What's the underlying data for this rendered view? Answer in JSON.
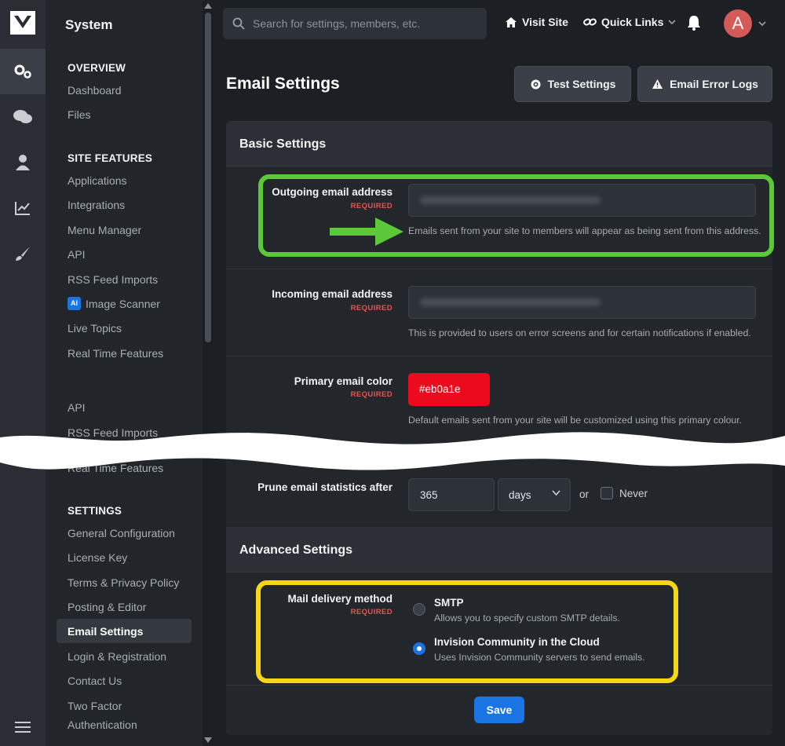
{
  "sidebar": {
    "title": "System",
    "sections": [
      {
        "heading": "OVERVIEW",
        "items": [
          "Dashboard",
          "Files"
        ]
      },
      {
        "heading": "SITE FEATURES",
        "items": [
          "Applications",
          "Integrations",
          "Menu Manager",
          "API",
          "RSS Feed Imports",
          "Image Scanner",
          "Live Topics",
          "Real Time Features"
        ]
      },
      {
        "heading": "SETTINGS",
        "items": [
          "General Configuration",
          "License Key",
          "Terms & Privacy Policy",
          "Posting & Editor",
          "Email Settings",
          "Login & Registration",
          "Contact Us",
          "Two Factor",
          "Authentication"
        ]
      }
    ],
    "ai_badge": "AI",
    "repeat_items": [
      "API",
      "RSS Feed Imports",
      "Real Time Features"
    ],
    "active_item": "Email Settings"
  },
  "topbar": {
    "search_placeholder": "Search for settings, members, etc.",
    "visit_site": "Visit Site",
    "quick_links": "Quick Links",
    "avatar_letter": "A"
  },
  "page": {
    "title": "Email Settings",
    "test_settings": "Test Settings",
    "error_logs": "Email Error Logs"
  },
  "basic": {
    "heading": "Basic Settings",
    "required": "REQUIRED",
    "outgoing": {
      "label": "Outgoing email address",
      "help": "Emails sent from your site to members will appear as being sent from this address."
    },
    "incoming": {
      "label": "Incoming email address",
      "help": "This is provided to users on error screens and for certain notifications if enabled."
    },
    "color": {
      "label": "Primary email color",
      "value": "#eb0a1e",
      "help": "Default emails sent from your site will be customized using this primary colour."
    },
    "prune": {
      "label": "Prune email statistics after",
      "value": "365",
      "unit": "days",
      "or": "or",
      "never": "Never"
    }
  },
  "advanced": {
    "heading": "Advanced Settings",
    "label": "Mail delivery method",
    "options": [
      {
        "title": "SMTP",
        "desc": "Allows you to specify custom SMTP details.",
        "selected": false
      },
      {
        "title": "Invision Community in the Cloud",
        "desc": "Uses Invision Community servers to send emails.",
        "selected": true
      }
    ]
  },
  "save": "Save",
  "colors": {
    "accent": "#1b74e4",
    "required": "#e45453",
    "highlight_green": "#5bc83a",
    "highlight_yellow": "#f5d717"
  }
}
